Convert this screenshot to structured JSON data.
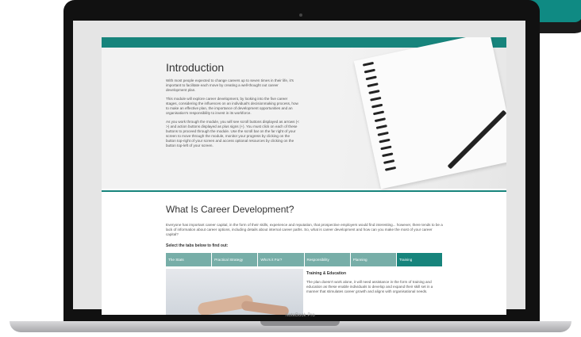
{
  "device": {
    "brand": "NoteBook Pro"
  },
  "intro": {
    "title": "Introduction",
    "paragraphs": [
      "With most people expected to change careers up to seven times in their life, it's important to facilitate each move by creating a well-thought out career development plan.",
      "This module will explore career development, by looking into the five career stages, considering the influences on an individual's decisionmaking process, how to make an effective plan, the importance of development opportunities and an organisation's responsibility to invest in its workforce.",
      "As you work through the module, you will see scroll buttons displayed as arrows (< >) and action buttons displayed as plus signs (+). You must click on each of these buttons to proceed through the module. Use the scroll bar on the far right of your screen to move through the module, monitor your progress by clicking on the button top-right of your screen and access optional resources by clicking on the button top-left of your screen."
    ]
  },
  "section": {
    "title": "What Is Career Development?",
    "body": "Everyone has important career capital, in the form of their skills, experience and reputation, that prospective employers would find interesting... however, there tends to be a lack of information about career options, including details about internal career paths. So, what is career development and how can you make the most of your career capital?",
    "select_label": "Select the tabs below to find out:"
  },
  "tabs": [
    {
      "label": "The Stats"
    },
    {
      "label": "Practical Strategy"
    },
    {
      "label": "Who's it For?"
    },
    {
      "label": "Responsibility"
    },
    {
      "label": "Planning"
    },
    {
      "label": "Training",
      "active": true
    }
  ],
  "panel": {
    "title": "Training & Education",
    "text": "The plan doesn't work alone, it will need assistance in the form of training and education as these enable individuals to develop and expand their skill set in a manner that stimulates career growth and aligns with organisational needs."
  },
  "colors": {
    "accent": "#17847c",
    "tab": "#77aea8"
  }
}
